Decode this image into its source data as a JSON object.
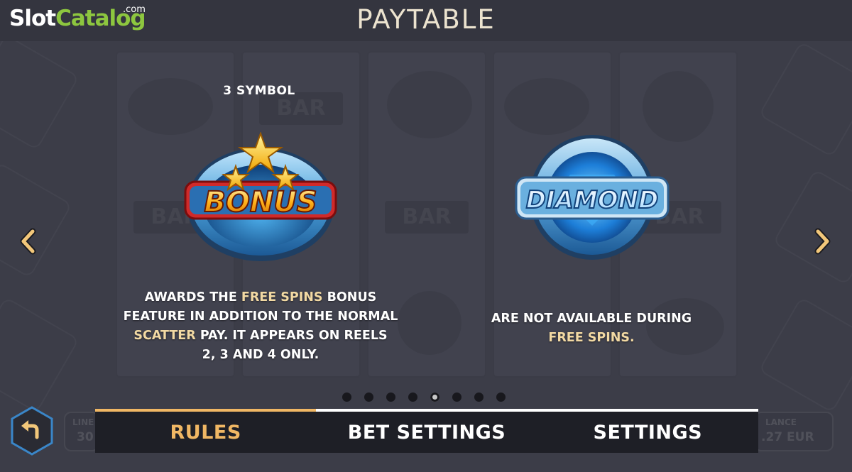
{
  "logo": {
    "part1": "Slot",
    "part2": "Catalog",
    "suffix": ".com"
  },
  "header": {
    "title": "PAYTABLE"
  },
  "background": {
    "left_box": {
      "label": "LINE",
      "value": "30"
    },
    "right_box": {
      "label": "LANCE",
      "value": ".27 EUR"
    },
    "bar_label": "BAR"
  },
  "bonus": {
    "label": "3 SYMBOL",
    "badge_text": "BONUS",
    "desc": {
      "l1a": "AWARDS THE ",
      "l1b": "FREE SPINS",
      "l1c": " BONUS",
      "l2": "FEATURE IN ADDITION TO THE NORMAL",
      "l3a": "SCATTER",
      "l3b": " PAY. IT APPEARS ON REELS",
      "l4": "2, 3 AND 4 ONLY."
    }
  },
  "diamond": {
    "badge_text": "DIAMOND",
    "desc": {
      "l1": "ARE NOT AVAILABLE DURING",
      "l2": "FREE SPINS."
    }
  },
  "pagination": {
    "total": 8,
    "active": 5
  },
  "tabs": [
    {
      "label": "RULES",
      "active": true
    },
    {
      "label": "BET SETTINGS",
      "active": false
    },
    {
      "label": "SETTINGS",
      "active": false
    }
  ],
  "colors": {
    "accent": "#f0b764",
    "highlight": "#f2d9a3",
    "logo_green": "#8dc63f",
    "title": "#ece3cf"
  },
  "icons": {
    "prev": "chevron-left-icon",
    "next": "chevron-right-icon",
    "back": "undo-arrow-icon"
  }
}
